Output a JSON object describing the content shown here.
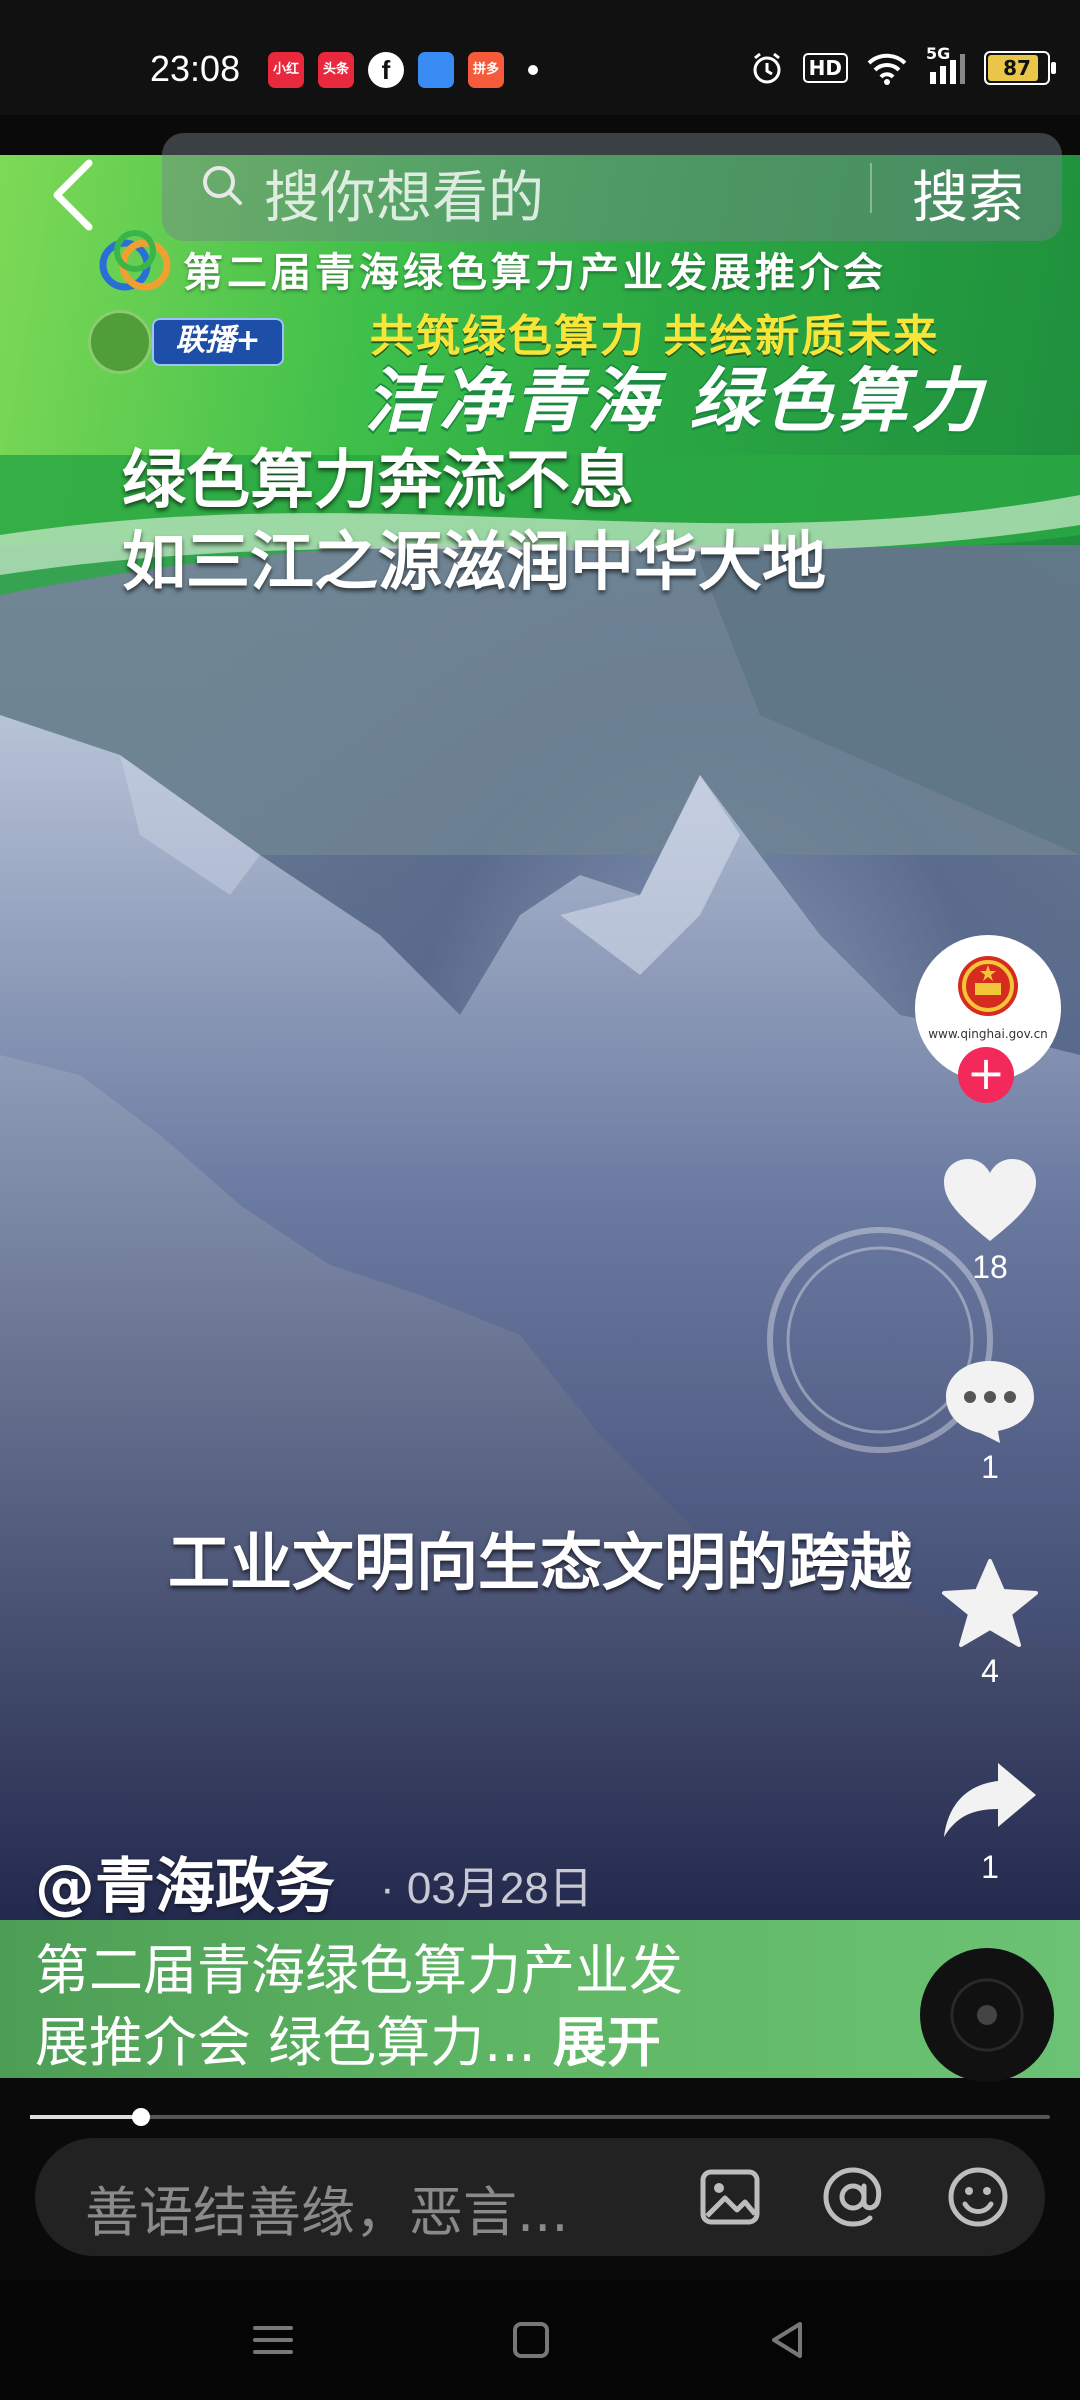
{
  "status_bar": {
    "time": "23:08",
    "notifications": [
      "小红书",
      "头条",
      "f",
      "",
      "拼多多"
    ],
    "indicators": [
      "alarm-icon",
      "HD",
      "wifi-icon",
      "5G"
    ],
    "network": "5G",
    "hd": "HD",
    "battery": "87"
  },
  "search": {
    "placeholder": "搜你想看的",
    "button": "搜索"
  },
  "video": {
    "event_title": "第二届青海绿色算力产业发展推介会",
    "badge": "联播+",
    "slogan_line1": "共筑绿色算力 共绘新质未来",
    "slogan_line2": "洁净青海  绿色算力",
    "caption_top_line1": "绿色算力奔流不息",
    "caption_top_line2": "如三江之源滋润中华大地",
    "caption_mid": "工业文明向生态文明的跨越"
  },
  "actions": {
    "avatar_site": "www.qinghai.gov.cn",
    "likes": "18",
    "comments": "1",
    "favorites": "4",
    "shares": "1"
  },
  "post": {
    "author": "@青海政务",
    "date": "· 03月28日",
    "desc_line1": "第二届青海绿色算力产业发",
    "desc_line2": "展推介会 绿色算力...",
    "expand": "展开",
    "progress": 0.109
  },
  "comment": {
    "placeholder": "善语结善缘，恶言..."
  },
  "colors": {
    "banner_green": "#3fbf4a",
    "like_red": "#f2295a"
  }
}
